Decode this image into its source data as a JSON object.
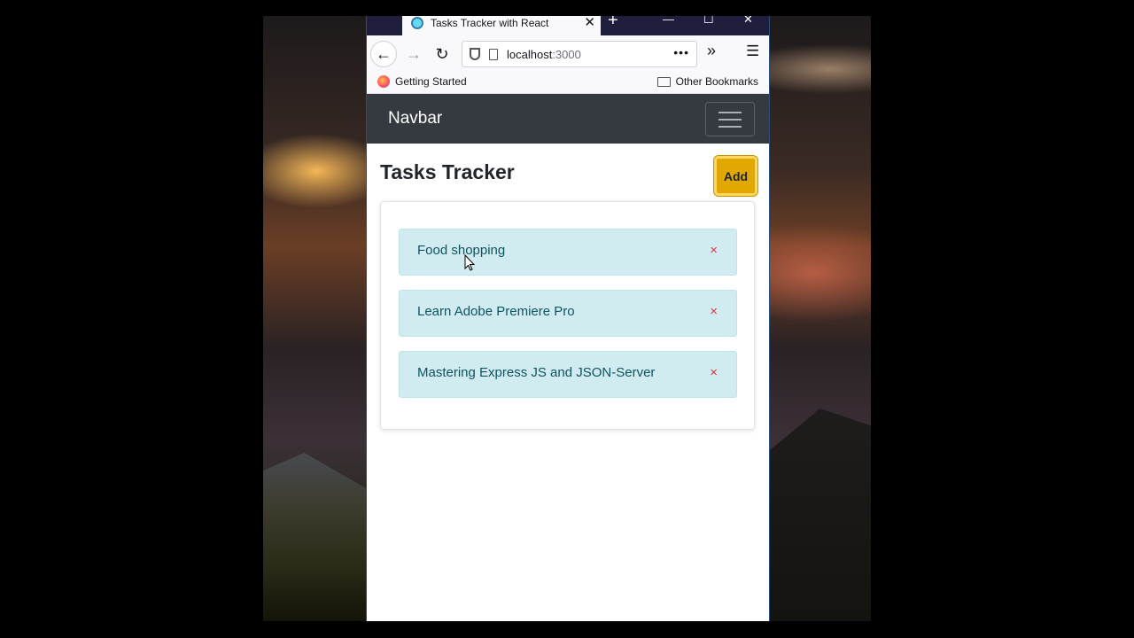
{
  "browser": {
    "tab_title": "Tasks Tracker with React",
    "url_host": "localhost",
    "url_port": ":3000",
    "bookmarks": {
      "getting_started": "Getting Started",
      "other": "Other Bookmarks"
    }
  },
  "app": {
    "brand": "Navbar",
    "title": "Tasks Tracker",
    "add_label": "Add",
    "tasks": [
      {
        "text": "Food shopping"
      },
      {
        "text": "Learn Adobe Premiere Pro"
      },
      {
        "text": "Mastering Express JS and JSON-Server"
      }
    ],
    "delete_glyph": "×"
  },
  "colors": {
    "navbar_bg": "#343a40",
    "add_button": "#e0a800",
    "task_bg": "#d1ecf1",
    "delete_color": "#dc3545"
  }
}
